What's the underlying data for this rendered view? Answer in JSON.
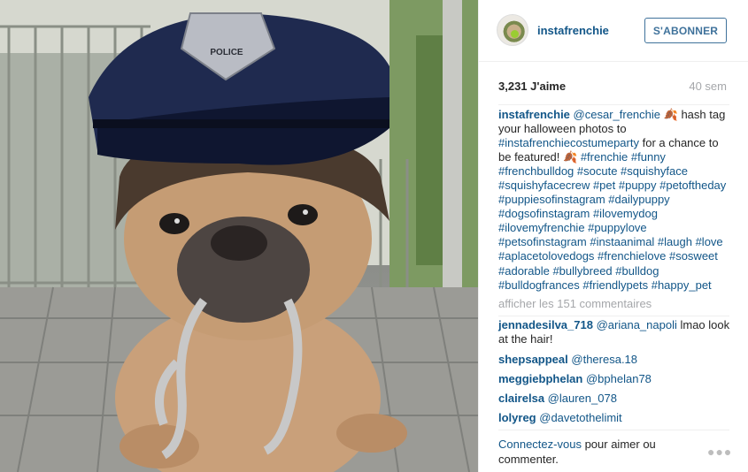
{
  "post": {
    "username": "instafrenchie",
    "follow_label": "S'ABONNER",
    "likes": "3,231 J'aime",
    "age": "40 sem",
    "caption_user": "instafrenchie",
    "caption": {
      "mention": "@cesar_frenchie",
      "text1": " hash tag your halloween photos to ",
      "tag1": "#instafrenchiecostumeparty",
      "text2": " for a chance to be featured! ",
      "emoji1": "🍂",
      "emoji2": "🍂",
      "tags": "#frenchie #funny #frenchbulldog #socute #squishyface #squishyfacecrew #pet #puppy #petoftheday #puppiesofinstagram #dailypuppy #dogsofinstagram #ilovemydog #ilovemyfrenchie #puppylove #petsofinstagram #instaanimal #laugh #love #aplacetolovedogs #frenchielove #sosweet #adorable #bullybreed #bulldog #bulldogfrances #friendlypets #happy_pet"
    },
    "show_comments": "afficher les 151 commentaires",
    "comments": [
      {
        "user": "jennadesilva_718",
        "mention": "@ariana_napoli",
        "text": " lmao look at the hair!"
      },
      {
        "user": "shepsappeal",
        "mention": "@theresa.18",
        "text": ""
      },
      {
        "user": "meggiebphelan",
        "mention": "@bphelan78",
        "text": ""
      },
      {
        "user": "clairelsa",
        "mention": "@lauren_078",
        "text": ""
      },
      {
        "user": "lolyreg",
        "mention": "@davetothelimit",
        "text": ""
      }
    ],
    "footer_link": "Connectez-vous",
    "footer_text": " pour aimer ou commenter.",
    "more_icon": "ellipsis-icon",
    "photo_badge_text": "POLICE"
  }
}
